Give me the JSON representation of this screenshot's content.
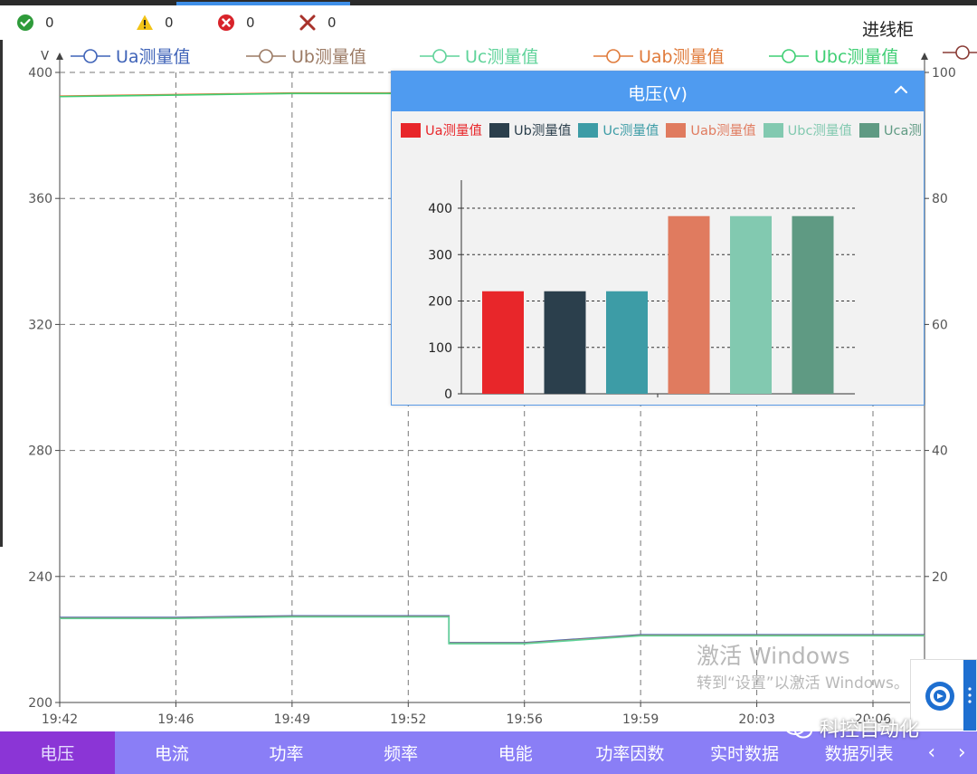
{
  "status_bar": {
    "ok_count": "0",
    "warn_count": "0",
    "error_count": "0",
    "cross_count": "0",
    "title": "进线柜"
  },
  "main_chart": {
    "y_unit": "V",
    "y_ticks": [
      "400",
      "360",
      "320",
      "280",
      "240",
      "200"
    ],
    "y2_ticks": [
      "100",
      "80",
      "60",
      "40",
      "20"
    ],
    "x_ticks": [
      "19:42",
      "19:46",
      "19:49",
      "19:52",
      "19:56",
      "19:59",
      "20:03",
      "20:06"
    ],
    "legend": [
      {
        "label": "Ua测量值",
        "color": "#3f63b8"
      },
      {
        "label": "Ub测量值",
        "color": "#9b7a64"
      },
      {
        "label": "Uc测量值",
        "color": "#5fd39a"
      },
      {
        "label": "Uab测量值",
        "color": "#e07a3a"
      },
      {
        "label": "Ubc测量值",
        "color": "#3fcf74"
      }
    ]
  },
  "popup": {
    "title": "电压(V)",
    "legend": [
      {
        "label": "Ua测量值",
        "color": "#e8262a"
      },
      {
        "label": "Ub测量值",
        "color": "#2b3f4c"
      },
      {
        "label": "Uc测量值",
        "color": "#3d9ca6"
      },
      {
        "label": "Uab测量值",
        "color": "#e07b5f"
      },
      {
        "label": "Ubc测量值",
        "color": "#82c9b0"
      },
      {
        "label": "Uca测量值",
        "color": "#5f9a83"
      }
    ],
    "y_ticks": [
      "400",
      "300",
      "200",
      "100",
      "0"
    ]
  },
  "chart_data": [
    {
      "type": "line",
      "title": "",
      "xlabel": "",
      "ylabel": "V",
      "ylim": [
        200,
        400
      ],
      "y2lim": [
        0,
        100
      ],
      "x": [
        "19:42",
        "19:46",
        "19:49",
        "19:52",
        "19:56",
        "19:59",
        "20:03",
        "20:06"
      ],
      "series": [
        {
          "name": "Ua测量值",
          "values": [
            227,
            227,
            227.5,
            227.5,
            219,
            221.5,
            221.5,
            221.5
          ]
        },
        {
          "name": "Ub测量值",
          "values": [
            227,
            227,
            227.5,
            227.5,
            219,
            221.5,
            221.5,
            221.5
          ]
        },
        {
          "name": "Uc测量值",
          "values": [
            227,
            227,
            227.5,
            227.5,
            219,
            221.5,
            221.5,
            221.5
          ]
        },
        {
          "name": "Uab测量值",
          "values": [
            393,
            393.5,
            394,
            394,
            null,
            null,
            null,
            null
          ]
        },
        {
          "name": "Ubc测量值",
          "values": [
            393,
            393.5,
            394,
            394,
            null,
            null,
            null,
            null
          ]
        }
      ],
      "legend": "top",
      "grid": true
    },
    {
      "type": "bar",
      "title": "电压(V)",
      "categories": [
        "Ua测量值",
        "Ub测量值",
        "Uc测量值",
        "Uab测量值",
        "Ubc测量值",
        "Uca测量值"
      ],
      "values": [
        221,
        221,
        221,
        383,
        383,
        383
      ],
      "ylim": [
        0,
        450
      ],
      "grid": true
    }
  ],
  "bottom_nav": {
    "tabs": [
      "电压",
      "电流",
      "功率",
      "频率",
      "电能",
      "功率因数",
      "实时数据",
      "数据列表"
    ],
    "prev": "‹",
    "next": "›"
  },
  "watermark": {
    "line1": "激活 Windows",
    "line2": "转到“设置”以激活 Windows。"
  },
  "brand": "科控自动化"
}
